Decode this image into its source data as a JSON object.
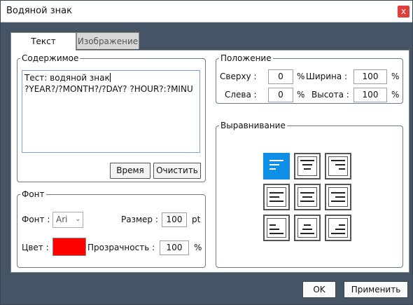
{
  "window": {
    "title": "Водяной знак",
    "close_label": "x"
  },
  "tabs": [
    {
      "label": "Текст"
    },
    {
      "label": "Изображение"
    }
  ],
  "content": {
    "legend": "Содержимое",
    "line1": "Тест: водяной знак",
    "line2": "?YEAR?/?MONTH?/?DAY? ?HOUR?:?MINU",
    "time_button": "Время",
    "clear_button": "Очистить"
  },
  "font": {
    "legend": "Фонт",
    "font_label": "Фонт :",
    "font_value": "Ari",
    "size_label": "Размер :",
    "size_value": "100",
    "size_unit": "pt",
    "color_label": "Цвет :",
    "color_value": "#ff0000",
    "transparency_label": "Прозрачность :",
    "transparency_value": "100",
    "transparency_unit": "%"
  },
  "position": {
    "legend": "Положение",
    "top_label": "Сверху :",
    "top_value": "0",
    "top_unit": "%",
    "width_label": "Ширина :",
    "width_value": "100",
    "width_unit": "%",
    "left_label": "Слева :",
    "left_value": "0",
    "left_unit": "%",
    "height_label": "Высота :",
    "height_value": "100",
    "height_unit": "%"
  },
  "alignment": {
    "legend": "Выравнивание",
    "selected": "top-left",
    "options": [
      "top-left",
      "top-center",
      "top-right",
      "middle-left",
      "middle-center",
      "middle-right",
      "bottom-left",
      "bottom-center",
      "bottom-right"
    ]
  },
  "footer": {
    "ok_label": "OK",
    "apply_label": "Применить"
  },
  "colors": {
    "selected_alignment": "#0f8ee6",
    "window_background": "#465566",
    "close_button": "#e0403a"
  }
}
